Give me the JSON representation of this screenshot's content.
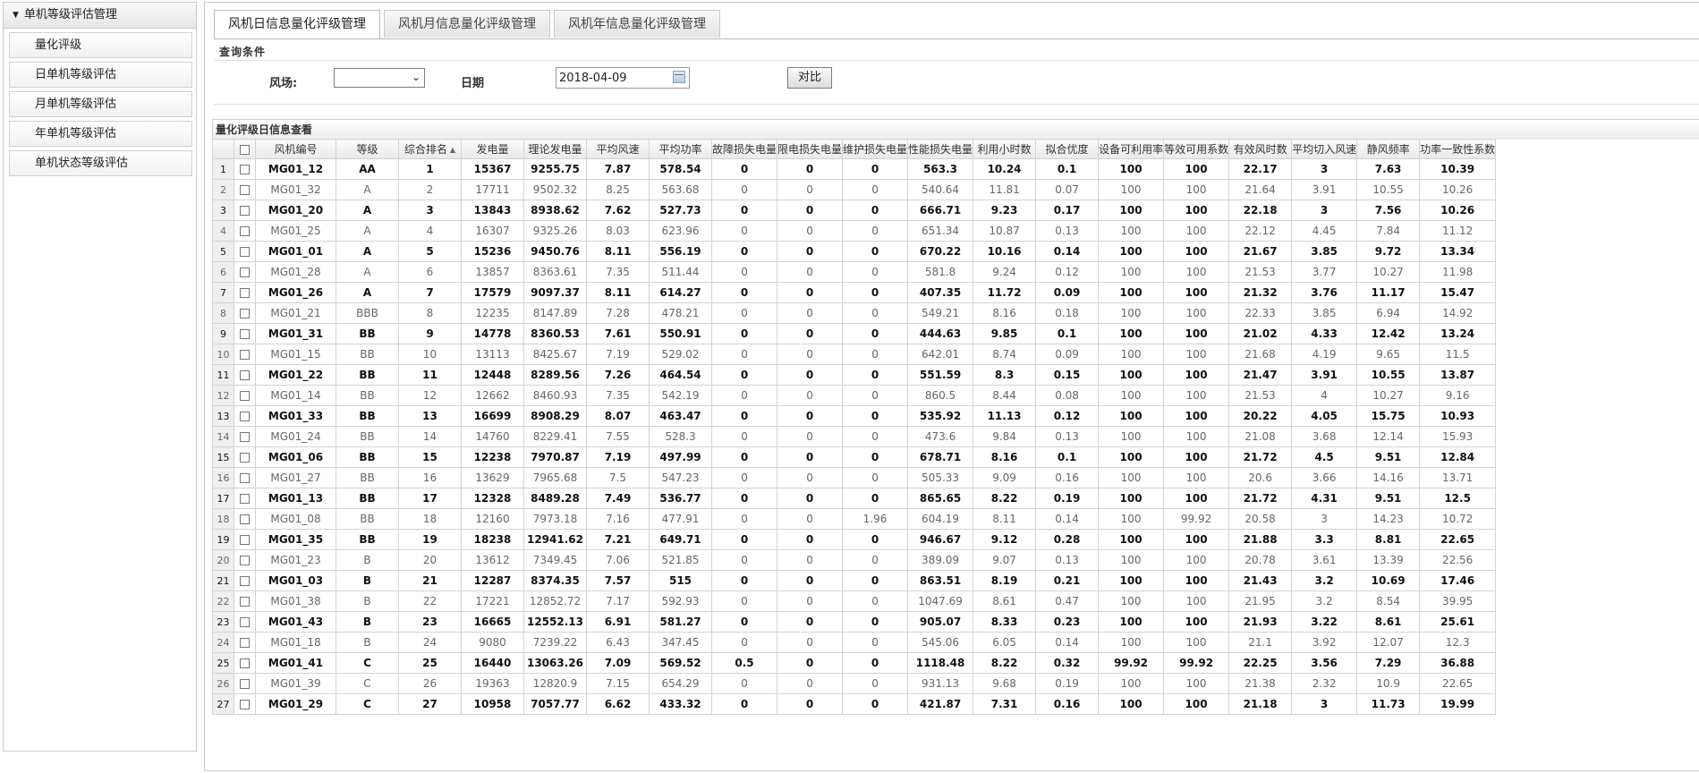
{
  "nav": {
    "header": "单机等级评估管理",
    "items": [
      "量化评级",
      "日单机等级评估",
      "月单机等级评估",
      "年单机等级评估",
      "单机状态等级评估"
    ]
  },
  "tabs": [
    "风机日信息量化评级管理",
    "风机月信息量化评级管理",
    "风机年信息量化评级管理"
  ],
  "active_tab": 0,
  "query": {
    "title": "查询条件",
    "farm_label": "风场:",
    "farm_value": "",
    "date_label": "日期",
    "date_value": "2018-04-09",
    "compare_label": "对比"
  },
  "grid": {
    "title": "量化评级日信息查看",
    "columns": [
      "风机编号",
      "等级",
      "综合排名",
      "发电量",
      "理论发电量",
      "平均风速",
      "平均功率",
      "故障损失电量",
      "限电损失电量",
      "维护损失电量",
      "性能损失电量",
      "利用小时数",
      "拟合优度",
      "设备可利用率",
      "等效可用系数",
      "有效风时数",
      "平均切入风速",
      "静风频率",
      "功率一致性系数"
    ],
    "sort_column": "综合排名",
    "rows": [
      [
        "MG01_12",
        "AA",
        "1",
        "15367",
        "9255.75",
        "7.87",
        "578.54",
        "0",
        "0",
        "0",
        "563.3",
        "10.24",
        "0.1",
        "100",
        "100",
        "22.17",
        "3",
        "7.63",
        "10.39"
      ],
      [
        "MG01_32",
        "A",
        "2",
        "17711",
        "9502.32",
        "8.25",
        "563.68",
        "0",
        "0",
        "0",
        "540.64",
        "11.81",
        "0.07",
        "100",
        "100",
        "21.64",
        "3.91",
        "10.55",
        "10.26"
      ],
      [
        "MG01_20",
        "A",
        "3",
        "13843",
        "8938.62",
        "7.62",
        "527.73",
        "0",
        "0",
        "0",
        "666.71",
        "9.23",
        "0.17",
        "100",
        "100",
        "22.18",
        "3",
        "7.56",
        "10.26"
      ],
      [
        "MG01_25",
        "A",
        "4",
        "16307",
        "9325.26",
        "8.03",
        "623.96",
        "0",
        "0",
        "0",
        "651.34",
        "10.87",
        "0.13",
        "100",
        "100",
        "22.12",
        "4.45",
        "7.84",
        "11.12"
      ],
      [
        "MG01_01",
        "A",
        "5",
        "15236",
        "9450.76",
        "8.11",
        "556.19",
        "0",
        "0",
        "0",
        "670.22",
        "10.16",
        "0.14",
        "100",
        "100",
        "21.67",
        "3.85",
        "9.72",
        "13.34"
      ],
      [
        "MG01_28",
        "A",
        "6",
        "13857",
        "8363.61",
        "7.35",
        "511.44",
        "0",
        "0",
        "0",
        "581.8",
        "9.24",
        "0.12",
        "100",
        "100",
        "21.53",
        "3.77",
        "10.27",
        "11.98"
      ],
      [
        "MG01_26",
        "A",
        "7",
        "17579",
        "9097.37",
        "8.11",
        "614.27",
        "0",
        "0",
        "0",
        "407.35",
        "11.72",
        "0.09",
        "100",
        "100",
        "21.32",
        "3.76",
        "11.17",
        "15.47"
      ],
      [
        "MG01_21",
        "BBB",
        "8",
        "12235",
        "8147.89",
        "7.28",
        "478.21",
        "0",
        "0",
        "0",
        "549.21",
        "8.16",
        "0.18",
        "100",
        "100",
        "22.33",
        "3.85",
        "6.94",
        "14.92"
      ],
      [
        "MG01_31",
        "BB",
        "9",
        "14778",
        "8360.53",
        "7.61",
        "550.91",
        "0",
        "0",
        "0",
        "444.63",
        "9.85",
        "0.1",
        "100",
        "100",
        "21.02",
        "4.33",
        "12.42",
        "13.24"
      ],
      [
        "MG01_15",
        "BB",
        "10",
        "13113",
        "8425.67",
        "7.19",
        "529.02",
        "0",
        "0",
        "0",
        "642.01",
        "8.74",
        "0.09",
        "100",
        "100",
        "21.68",
        "4.19",
        "9.65",
        "11.5"
      ],
      [
        "MG01_22",
        "BB",
        "11",
        "12448",
        "8289.56",
        "7.26",
        "464.54",
        "0",
        "0",
        "0",
        "551.59",
        "8.3",
        "0.15",
        "100",
        "100",
        "21.47",
        "3.91",
        "10.55",
        "13.87"
      ],
      [
        "MG01_14",
        "BB",
        "12",
        "12662",
        "8460.93",
        "7.35",
        "542.19",
        "0",
        "0",
        "0",
        "860.5",
        "8.44",
        "0.08",
        "100",
        "100",
        "21.53",
        "4",
        "10.27",
        "9.16"
      ],
      [
        "MG01_33",
        "BB",
        "13",
        "16699",
        "8908.29",
        "8.07",
        "463.47",
        "0",
        "0",
        "0",
        "535.92",
        "11.13",
        "0.12",
        "100",
        "100",
        "20.22",
        "4.05",
        "15.75",
        "10.93"
      ],
      [
        "MG01_24",
        "BB",
        "14",
        "14760",
        "8229.41",
        "7.55",
        "528.3",
        "0",
        "0",
        "0",
        "473.6",
        "9.84",
        "0.13",
        "100",
        "100",
        "21.08",
        "3.68",
        "12.14",
        "15.93"
      ],
      [
        "MG01_06",
        "BB",
        "15",
        "12238",
        "7970.87",
        "7.19",
        "497.99",
        "0",
        "0",
        "0",
        "678.71",
        "8.16",
        "0.1",
        "100",
        "100",
        "21.72",
        "4.5",
        "9.51",
        "12.84"
      ],
      [
        "MG01_27",
        "BB",
        "16",
        "13629",
        "7965.68",
        "7.5",
        "547.23",
        "0",
        "0",
        "0",
        "505.33",
        "9.09",
        "0.16",
        "100",
        "100",
        "20.6",
        "3.66",
        "14.16",
        "13.71"
      ],
      [
        "MG01_13",
        "BB",
        "17",
        "12328",
        "8489.28",
        "7.49",
        "536.77",
        "0",
        "0",
        "0",
        "865.65",
        "8.22",
        "0.19",
        "100",
        "100",
        "21.72",
        "4.31",
        "9.51",
        "12.5"
      ],
      [
        "MG01_08",
        "BB",
        "18",
        "12160",
        "7973.18",
        "7.16",
        "477.91",
        "0",
        "0",
        "1.96",
        "604.19",
        "8.11",
        "0.14",
        "100",
        "99.92",
        "20.58",
        "3",
        "14.23",
        "10.72"
      ],
      [
        "MG01_35",
        "BB",
        "19",
        "18238",
        "12941.62",
        "7.21",
        "649.71",
        "0",
        "0",
        "0",
        "946.67",
        "9.12",
        "0.28",
        "100",
        "100",
        "21.88",
        "3.3",
        "8.81",
        "22.65"
      ],
      [
        "MG01_23",
        "B",
        "20",
        "13612",
        "7349.45",
        "7.06",
        "521.85",
        "0",
        "0",
        "0",
        "389.09",
        "9.07",
        "0.13",
        "100",
        "100",
        "20.78",
        "3.61",
        "13.39",
        "22.56"
      ],
      [
        "MG01_03",
        "B",
        "21",
        "12287",
        "8374.35",
        "7.57",
        "515",
        "0",
        "0",
        "0",
        "863.51",
        "8.19",
        "0.21",
        "100",
        "100",
        "21.43",
        "3.2",
        "10.69",
        "17.46"
      ],
      [
        "MG01_38",
        "B",
        "22",
        "17221",
        "12852.72",
        "7.17",
        "592.93",
        "0",
        "0",
        "0",
        "1047.69",
        "8.61",
        "0.47",
        "100",
        "100",
        "21.95",
        "3.2",
        "8.54",
        "39.95"
      ],
      [
        "MG01_43",
        "B",
        "23",
        "16665",
        "12552.13",
        "6.91",
        "581.27",
        "0",
        "0",
        "0",
        "905.07",
        "8.33",
        "0.23",
        "100",
        "100",
        "21.93",
        "3.22",
        "8.61",
        "25.61"
      ],
      [
        "MG01_18",
        "B",
        "24",
        "9080",
        "7239.22",
        "6.43",
        "347.45",
        "0",
        "0",
        "0",
        "545.06",
        "6.05",
        "0.14",
        "100",
        "100",
        "21.1",
        "3.92",
        "12.07",
        "12.3"
      ],
      [
        "MG01_41",
        "C",
        "25",
        "16440",
        "13063.26",
        "7.09",
        "569.52",
        "0.5",
        "0",
        "0",
        "1118.48",
        "8.22",
        "0.32",
        "99.92",
        "99.92",
        "22.25",
        "3.56",
        "7.29",
        "36.88"
      ],
      [
        "MG01_39",
        "C",
        "26",
        "19363",
        "12820.9",
        "7.15",
        "654.29",
        "0",
        "0",
        "0",
        "931.13",
        "9.68",
        "0.19",
        "100",
        "100",
        "21.38",
        "2.32",
        "10.9",
        "22.65"
      ],
      [
        "MG01_29",
        "C",
        "27",
        "10958",
        "7057.77",
        "6.62",
        "433.32",
        "0",
        "0",
        "0",
        "421.87",
        "7.31",
        "0.16",
        "100",
        "100",
        "21.18",
        "3",
        "11.73",
        "19.99"
      ]
    ]
  }
}
